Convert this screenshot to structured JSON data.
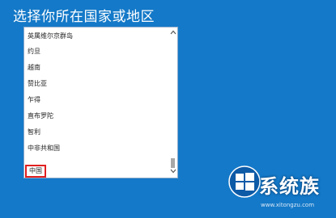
{
  "page": {
    "title": "选择你所在国家或地区"
  },
  "country_list": {
    "items": [
      {
        "label": "英属维尔京群岛"
      },
      {
        "label": "约旦"
      },
      {
        "label": "越南"
      },
      {
        "label": "赞比亚"
      },
      {
        "label": "乍得"
      },
      {
        "label": "直布罗陀"
      },
      {
        "label": "智利"
      },
      {
        "label": "中非共和国"
      },
      {
        "label": "中国",
        "selected": true
      }
    ],
    "selected_value": "中国",
    "scroll_up_icon": "chevron-up-icon",
    "scroll_down_icon": "chevron-down-icon",
    "scroll_position": 0.92
  },
  "watermark": {
    "text": "系统族",
    "url": "www.xitongzu.com",
    "logo_icon": "windows-logo-icon"
  },
  "colors": {
    "background": "#1479c8",
    "selection_outline": "#e02020",
    "list_background": "#ffffff"
  }
}
